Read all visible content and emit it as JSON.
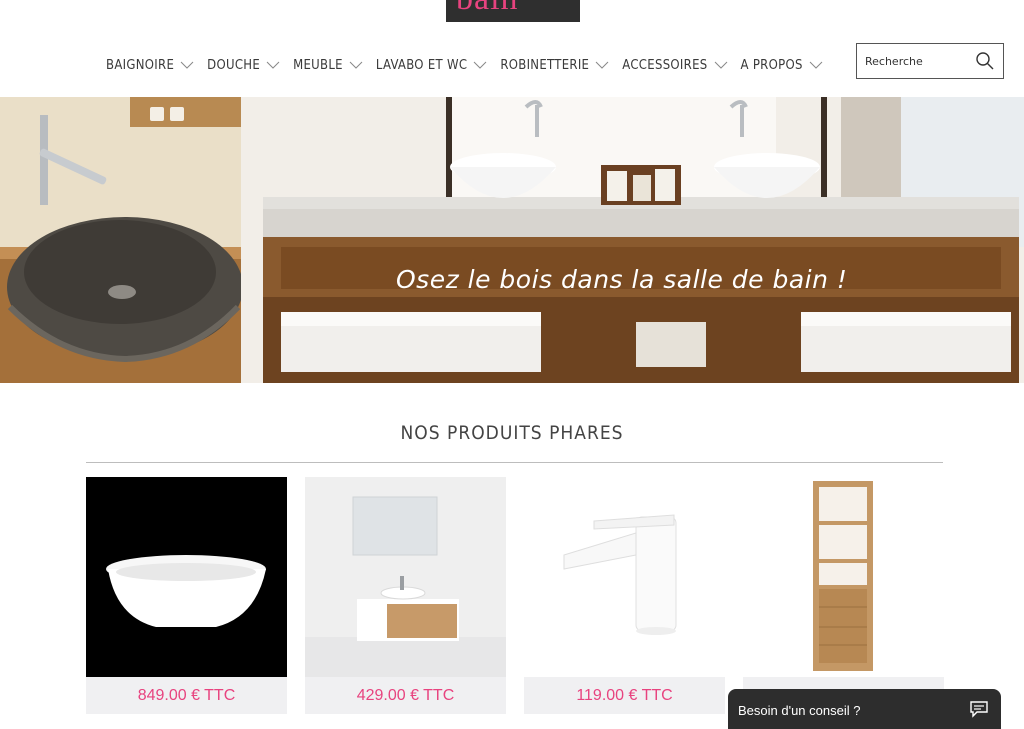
{
  "header": {
    "logo_text": "bain"
  },
  "nav": {
    "items": [
      {
        "label": "BAIGNOIRE"
      },
      {
        "label": "DOUCHE"
      },
      {
        "label": "MEUBLE"
      },
      {
        "label": "LAVABO ET WC"
      },
      {
        "label": "ROBINETTERIE"
      },
      {
        "label": "ACCESSOIRES"
      },
      {
        "label": "A PROPOS"
      }
    ]
  },
  "search": {
    "placeholder": "Recherche"
  },
  "hero": {
    "caption": "Osez le bois dans la salle de bain !"
  },
  "featured": {
    "title": "NOS PRODUITS PHARES",
    "products": [
      {
        "price": "849.00 € TTC",
        "image": "bathtub"
      },
      {
        "price": "429.00 € TTC",
        "image": "vanity-cabinet"
      },
      {
        "price": "119.00 € TTC",
        "image": "faucet"
      },
      {
        "price": "",
        "image": "wooden-column-shelf"
      }
    ]
  },
  "chat": {
    "label": "Besoin d'un conseil ?"
  },
  "colors": {
    "accent": "#e8437f",
    "chat_bg": "#2d2d2d",
    "price_bg": "#f0f0f2"
  }
}
